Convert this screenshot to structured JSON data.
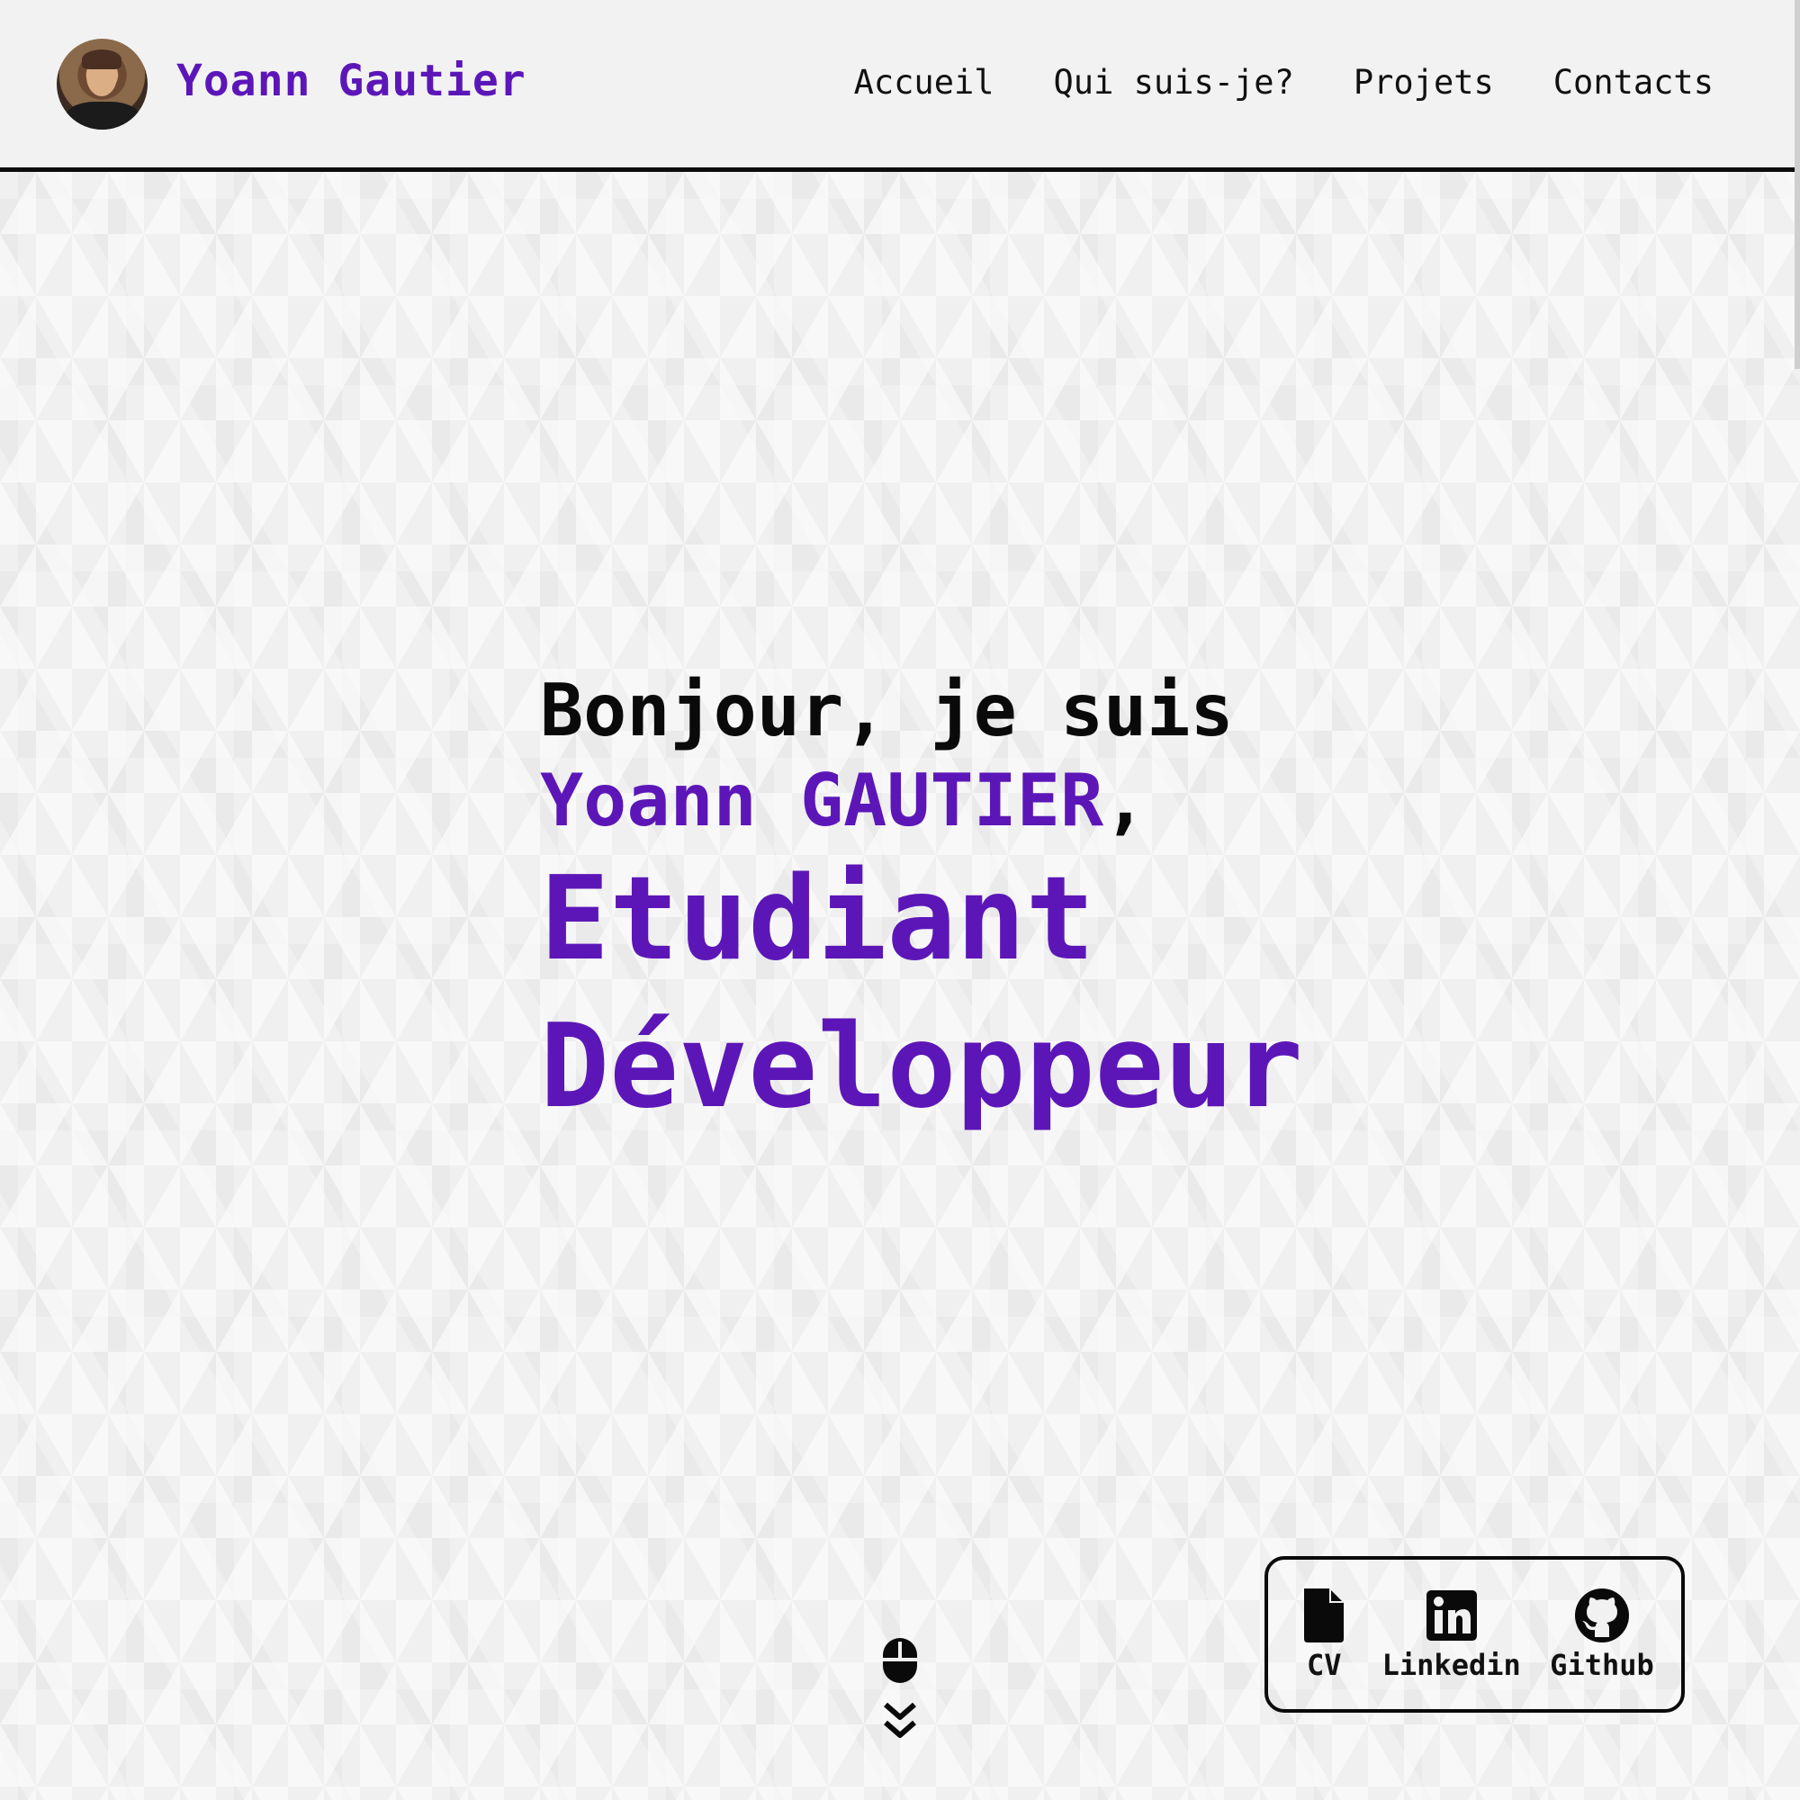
{
  "header": {
    "brand": "Yoann Gautier",
    "nav": [
      {
        "label": "Accueil"
      },
      {
        "label": "Qui suis-je?"
      },
      {
        "label": "Projets"
      },
      {
        "label": "Contacts"
      }
    ]
  },
  "hero": {
    "greeting": "Bonjour, je suis",
    "name": "Yoann GAUTIER",
    "name_suffix": ",",
    "role1": "Etudiant",
    "role2": "Développeur"
  },
  "links": [
    {
      "label": "CV",
      "icon": "file-icon"
    },
    {
      "label": "Linkedin",
      "icon": "linkedin-icon"
    },
    {
      "label": "Github",
      "icon": "github-icon"
    }
  ],
  "colors": {
    "accent": "#5c16b8",
    "text": "#0a0a0a",
    "background": "#f1f1f1"
  }
}
